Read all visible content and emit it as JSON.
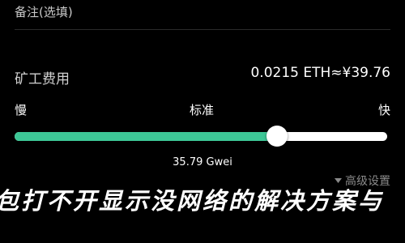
{
  "remarks": {
    "label": "备注(选填)"
  },
  "fee": {
    "label": "矿工费用",
    "value": "0.0215 ETH≈¥39.76"
  },
  "speed": {
    "slow_label": "慢",
    "standard_label": "标准",
    "fast_label": "快",
    "slider_level": 0.705,
    "gas_price": "35.79 Gwei"
  },
  "advanced": {
    "label": "高级设置",
    "icon": "triangle-down-icon"
  },
  "overlay": {
    "headline": "包打不开显示没网络的解决方案与"
  },
  "colors": {
    "background": "#000000",
    "slider_fill": "#3dc796",
    "slider_track": "#ffffff",
    "muted_text": "#8a8a8a"
  }
}
